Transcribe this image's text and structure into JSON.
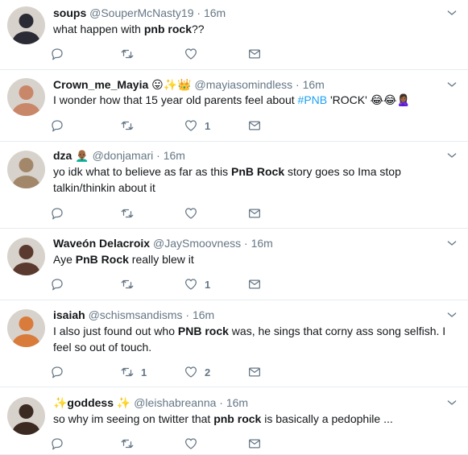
{
  "tweets": [
    {
      "name": "soups",
      "handle": "@SouperMcNasty19",
      "time": "16m",
      "badges": "",
      "text_parts": [
        {
          "t": "what happen with "
        },
        {
          "b": "pnb rock"
        },
        {
          "t": "??"
        }
      ],
      "reply_count": "",
      "retweet_count": "",
      "like_count": "",
      "avatar_color": "#2b2b36"
    },
    {
      "name": "Crown_me_Mayia",
      "handle": "@mayiasomindless",
      "time": "16m",
      "badges": "😛✨👑",
      "text_parts": [
        {
          "t": "I wonder how that 15 year old parents feel about "
        },
        {
          "h": "#PNB"
        },
        {
          "t": " 'ROCK' 😂😂🙎🏾‍♀️"
        }
      ],
      "reply_count": "",
      "retweet_count": "",
      "like_count": "1",
      "avatar_color": "#c9876a"
    },
    {
      "name": "dza",
      "handle": "@donjamari",
      "time": "16m",
      "badges": "👨🏾‍🦲",
      "text_parts": [
        {
          "t": "yo idk what to believe as far as this "
        },
        {
          "b": "PnB Rock"
        },
        {
          "t": " story goes so Ima stop talkin/thinkin about it"
        }
      ],
      "reply_count": "",
      "retweet_count": "",
      "like_count": "",
      "avatar_color": "#a3876a"
    },
    {
      "name": "Waveón Delacroix",
      "handle": "@JaySmoovness",
      "time": "16m",
      "badges": "",
      "text_parts": [
        {
          "t": "Aye "
        },
        {
          "b": "PnB Rock"
        },
        {
          "t": " really blew it"
        }
      ],
      "reply_count": "",
      "retweet_count": "",
      "like_count": "1",
      "avatar_color": "#5a3a2e"
    },
    {
      "name": "isaiah",
      "handle": "@schismsandisms",
      "time": "16m",
      "badges": "",
      "text_parts": [
        {
          "t": "I also just found out who "
        },
        {
          "b": "PNB rock"
        },
        {
          "t": " was, he sings that corny ass song selfish. I feel so out of touch."
        }
      ],
      "reply_count": "",
      "retweet_count": "1",
      "like_count": "2",
      "avatar_color": "#d97b3a"
    },
    {
      "name": "✨goddess ✨",
      "handle": "@leishabreanna",
      "time": "16m",
      "badges": "",
      "text_parts": [
        {
          "t": "so why im seeing on twitter that "
        },
        {
          "b": "pnb rock"
        },
        {
          "t": " is basically a pedophile ..."
        }
      ],
      "reply_count": "",
      "retweet_count": "",
      "like_count": "",
      "avatar_color": "#3b2a22"
    }
  ],
  "colors": {
    "text": "#14171a",
    "muted": "#657786",
    "link": "#1da1f2",
    "divider": "#e6ecf0"
  },
  "icons": {
    "reply": "reply-icon",
    "retweet": "retweet-icon",
    "like": "heart-icon",
    "message": "envelope-icon",
    "caret": "chevron-down-icon"
  }
}
